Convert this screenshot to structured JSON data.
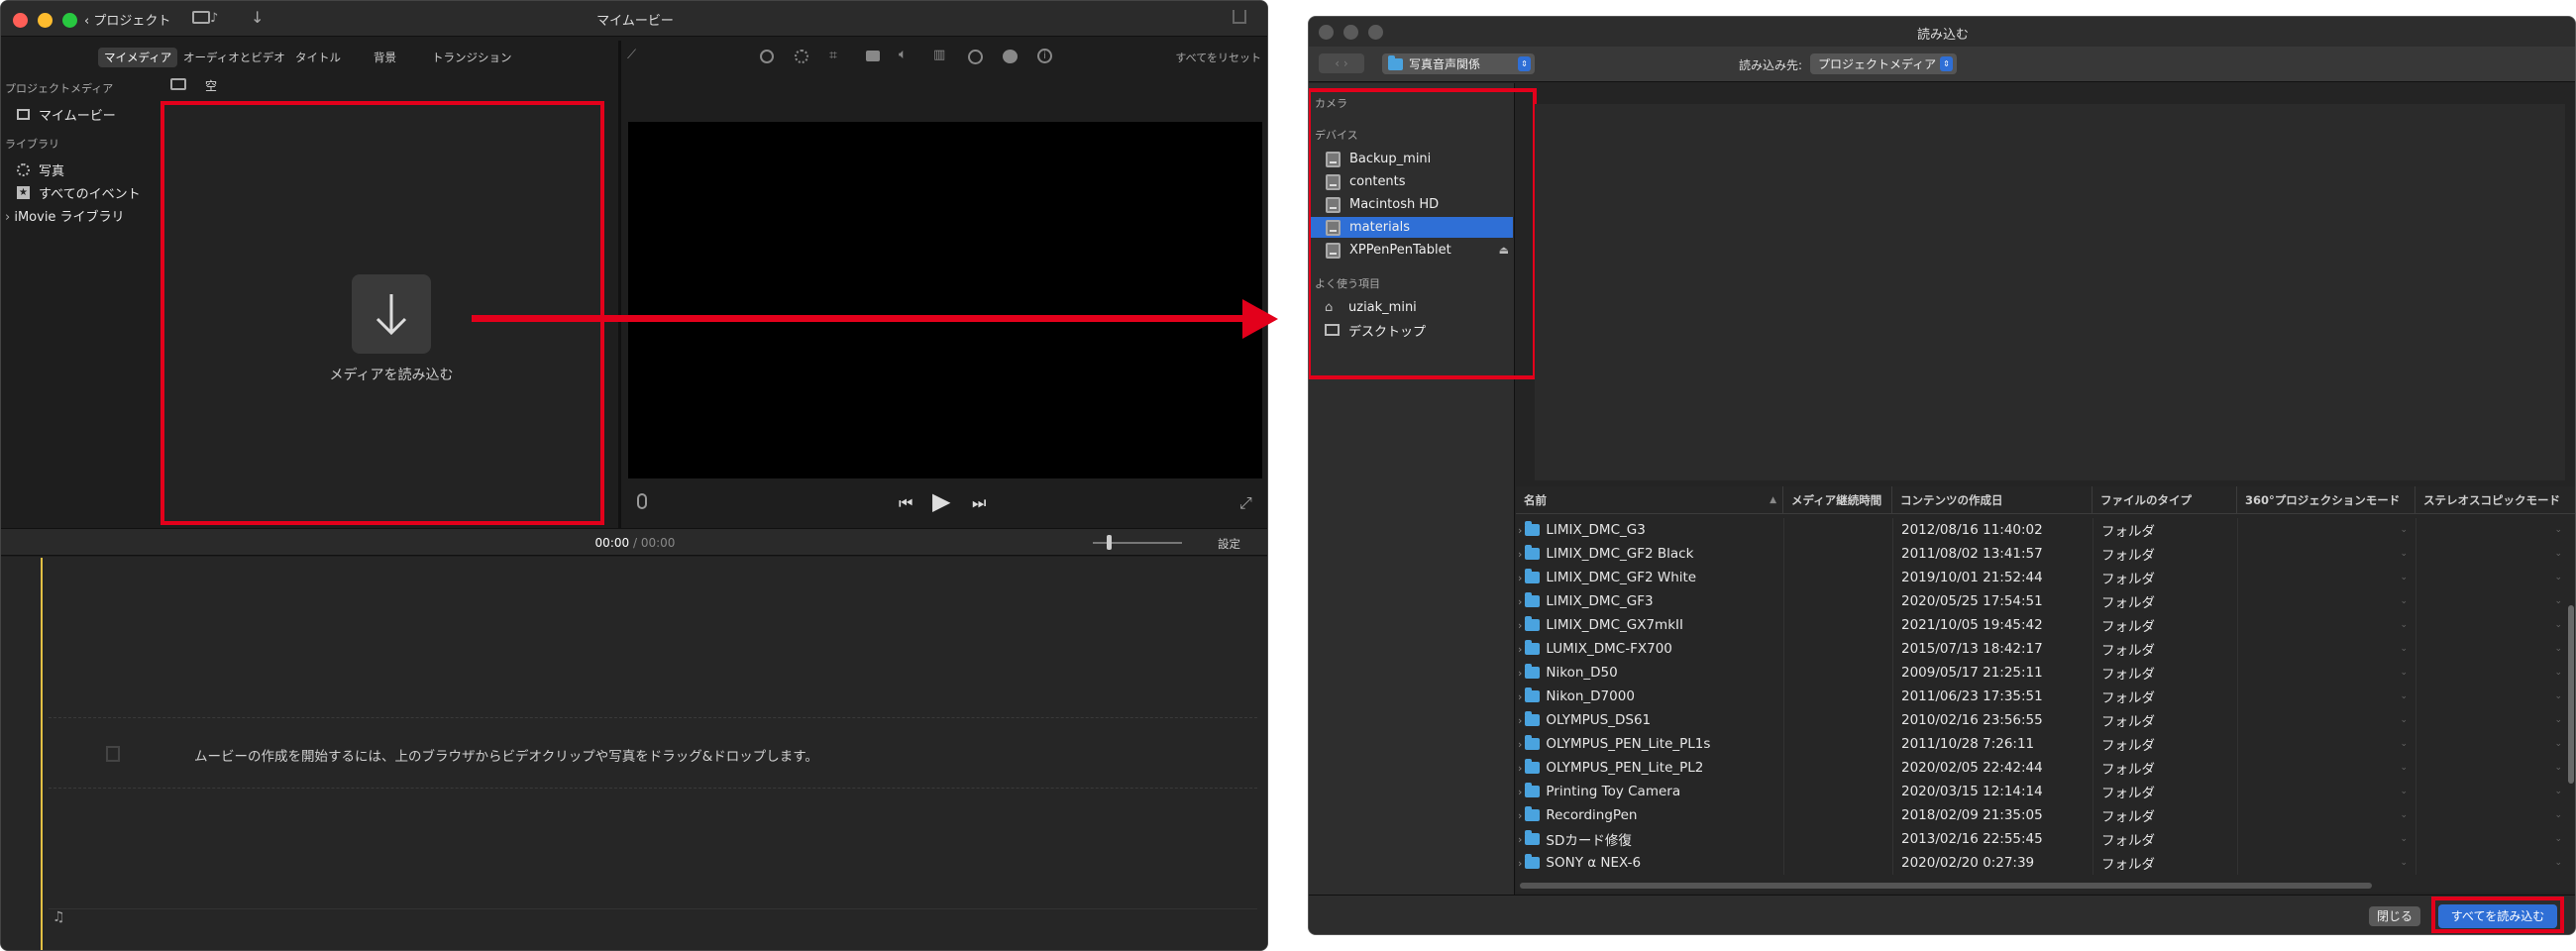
{
  "imovie": {
    "title": "マイムービー",
    "back_label": "プロジェクト",
    "tabs": [
      "マイメディア",
      "オーディオとビデオ",
      "タイトル",
      "背景",
      "トランジション"
    ],
    "reset_all": "すべてをリセット",
    "sidebar_section_project": "プロジェクトメディア",
    "sidebar_my_movie": "マイムービー",
    "sidebar_section_library": "ライブラリ",
    "sidebar_photos": "写真",
    "sidebar_all_events": "すべてのイベント",
    "sidebar_imovie_library": "iMovie ライブラリ",
    "filter_label": "空",
    "import_media_label": "メディアを読み込む",
    "timecode_current": "00:00",
    "timecode_sep": "/",
    "timecode_total": "00:00",
    "settings_label": "設定",
    "timeline_hint": "ムービーの作成を開始するには、上のブラウザからビデオクリップや写真をドラッグ&ドロップします。"
  },
  "importer": {
    "title": "読み込む",
    "location_popup": "写真音声関係",
    "import_to_label": "読み込み先:",
    "import_to_value": "プロジェクトメディア",
    "section_camera": "カメラ",
    "section_devices": "デバイス",
    "devices": [
      {
        "label": "Backup_mini",
        "selected": false,
        "eject": false
      },
      {
        "label": "contents",
        "selected": false,
        "eject": false
      },
      {
        "label": "Macintosh HD",
        "selected": false,
        "eject": false
      },
      {
        "label": "materials",
        "selected": true,
        "eject": false
      },
      {
        "label": "XPPenPenTablet",
        "selected": false,
        "eject": true
      }
    ],
    "section_favorites": "よく使う項目",
    "favorites": [
      {
        "label": "uziak_mini",
        "icon": "home-icon"
      },
      {
        "label": "デスクトップ",
        "icon": "desktop-icon"
      }
    ],
    "columns": [
      "名前",
      "メディア継続時間",
      "コンテンツの作成日",
      "ファイルのタイプ",
      "360°プロジェクションモード",
      "ステレオスコピックモード"
    ],
    "rows": [
      {
        "name": "LIMIX_DMC_G3",
        "date": "2012/08/16 11:40:02",
        "type": "フォルダ"
      },
      {
        "name": "LIMIX_DMC_GF2 Black",
        "date": "2011/08/02 13:41:57",
        "type": "フォルダ"
      },
      {
        "name": "LIMIX_DMC_GF2 White",
        "date": "2019/10/01 21:52:44",
        "type": "フォルダ"
      },
      {
        "name": "LIMIX_DMC_GF3",
        "date": "2020/05/25 17:54:51",
        "type": "フォルダ"
      },
      {
        "name": "LIMIX_DMC_GX7mkII",
        "date": "2021/10/05 19:45:42",
        "type": "フォルダ"
      },
      {
        "name": "LUMIX_DMC-FX700",
        "date": "2015/07/13 18:42:17",
        "type": "フォルダ"
      },
      {
        "name": "Nikon_D50",
        "date": "2009/05/17 21:25:11",
        "type": "フォルダ"
      },
      {
        "name": "Nikon_D7000",
        "date": "2011/06/23 17:35:51",
        "type": "フォルダ"
      },
      {
        "name": "OLYMPUS_DS61",
        "date": "2010/02/16 23:56:55",
        "type": "フォルダ"
      },
      {
        "name": "OLYMPUS_PEN_Lite_PL1s",
        "date": "2011/10/28 7:26:11",
        "type": "フォルダ"
      },
      {
        "name": "OLYMPUS_PEN_Lite_PL2",
        "date": "2020/02/05 22:42:44",
        "type": "フォルダ"
      },
      {
        "name": "Printing Toy Camera",
        "date": "2020/03/15 12:14:14",
        "type": "フォルダ"
      },
      {
        "name": "RecordingPen",
        "date": "2018/02/09 21:35:05",
        "type": "フォルダ"
      },
      {
        "name": "SDカード修復",
        "date": "2013/02/16 22:55:45",
        "type": "フォルダ"
      },
      {
        "name": "SONY α NEX-6",
        "date": "2020/02/20 0:27:39",
        "type": "フォルダ"
      }
    ],
    "close_button": "閉じる",
    "import_all_button": "すべてを読み込む"
  },
  "colors": {
    "highlight": "#e3001b",
    "accent": "#2f6fd6"
  }
}
